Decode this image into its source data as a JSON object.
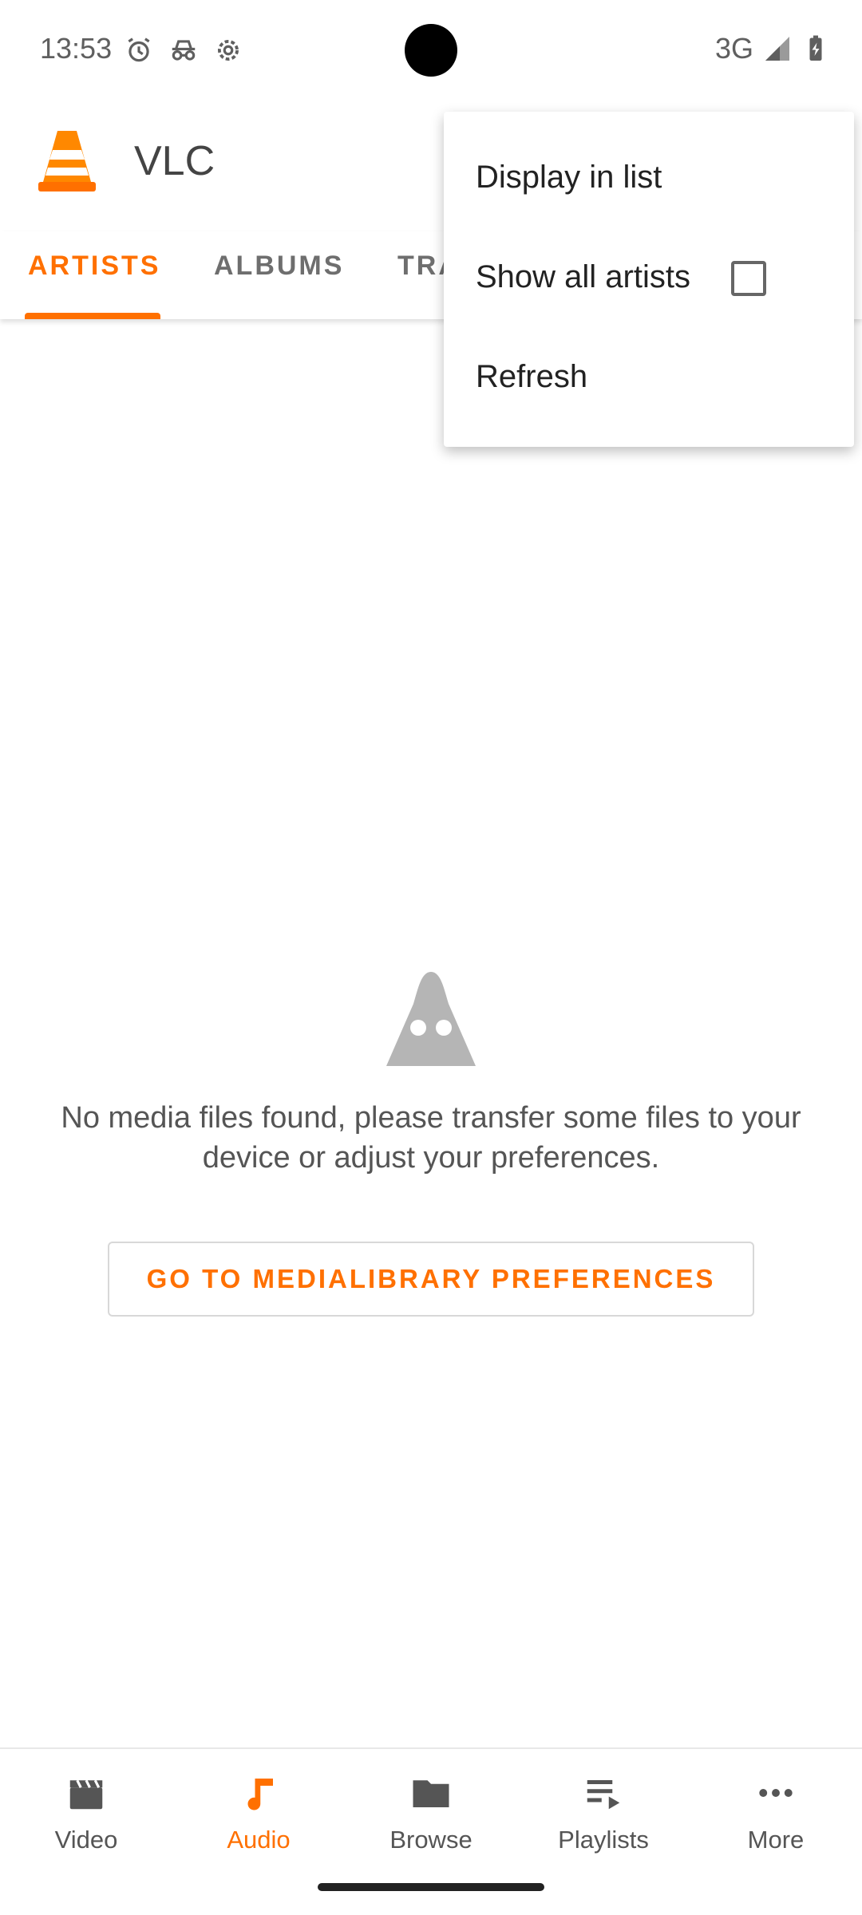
{
  "status_bar": {
    "time": "13:53",
    "network": "3G",
    "icons_left": [
      "alarm-icon",
      "incognito-icon",
      "settings-gear-icon"
    ],
    "icons_right": [
      "signal-icon",
      "battery-charging-icon"
    ]
  },
  "app_bar": {
    "title": "VLC",
    "logo": "vlc-cone-logo"
  },
  "tabs": [
    {
      "label": "ARTISTS",
      "active": true
    },
    {
      "label": "ALBUMS",
      "active": false
    },
    {
      "label": "TRACKS",
      "active": false
    }
  ],
  "empty_state": {
    "icon": "ghost-cone-icon",
    "message": "No media files found, please transfer some files to your device or adjust your preferences.",
    "button_label": "GO TO MEDIALIBRARY PREFERENCES"
  },
  "menu": {
    "items": [
      {
        "label": "Display in list"
      },
      {
        "label": "Show all artists",
        "checked": false
      },
      {
        "label": "Refresh"
      }
    ]
  },
  "bottom_nav": {
    "items": [
      {
        "label": "Video",
        "icon": "clapperboard-icon",
        "active": false
      },
      {
        "label": "Audio",
        "icon": "music-note-icon",
        "active": true
      },
      {
        "label": "Browse",
        "icon": "folder-icon",
        "active": false
      },
      {
        "label": "Playlists",
        "icon": "playlist-icon",
        "active": false
      },
      {
        "label": "More",
        "icon": "more-dots-icon",
        "active": false
      }
    ]
  },
  "colors": {
    "accent": "#ff7000",
    "text": "#444444"
  }
}
